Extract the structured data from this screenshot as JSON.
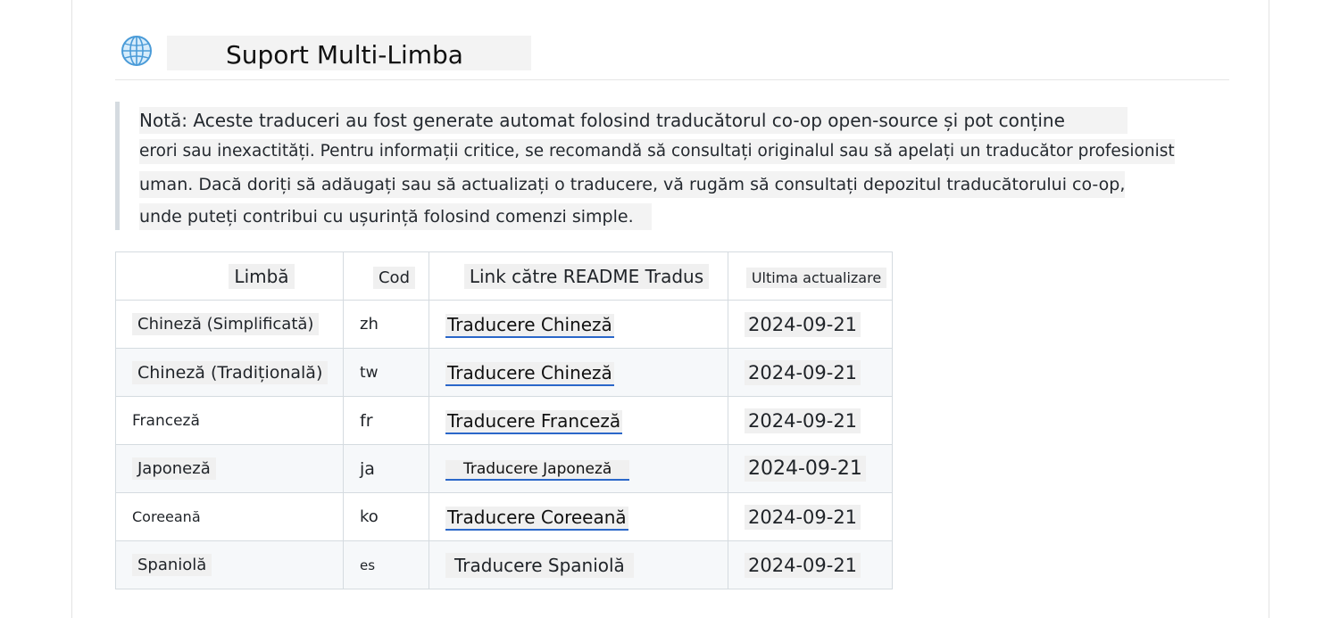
{
  "heading": {
    "title": "Suport Multi-Limba",
    "icon": "globe-icon"
  },
  "note": {
    "lines": [
      "Notă: Aceste traduceri au fost generate automat folosind traducătorul co-op open-source și pot conține",
      "erori sau inexactități. Pentru informații critice, se recomandă să consultați originalul sau să apelați un traducător profesionist",
      "uman. Dacă doriți să adăugați sau să actualizați o traducere, vă rugăm să consultați depozitul traducătorului co-op,",
      "unde puteți contribui cu ușurință folosind comenzi simple."
    ]
  },
  "table": {
    "headers": [
      "Limbă",
      "Cod",
      "Link către README Tradus",
      "Ultima actualizare"
    ],
    "rows": [
      {
        "language": "Chineză (Simplificată)",
        "code": "zh",
        "link": "Traducere Chineză",
        "updated": "2024-09-21"
      },
      {
        "language": "Chineză (Tradițională)",
        "code": "tw",
        "link": "Traducere Chineză",
        "updated": "2024-09-21"
      },
      {
        "language": "Franceză",
        "code": "fr",
        "link": "Traducere Franceză",
        "updated": "2024-09-21"
      },
      {
        "language": "Japoneză",
        "code": "ja",
        "link": "Traducere Japoneză",
        "updated": "2024-09-21"
      },
      {
        "language": "Coreeană",
        "code": "ko",
        "link": "Traducere Coreeană",
        "updated": "2024-09-21"
      },
      {
        "language": "Spaniolă",
        "code": "es",
        "link": "Traducere Spaniolă",
        "updated": "2024-09-21"
      }
    ]
  },
  "colors": {
    "link_underline": "#2a67c9",
    "blockquote_bar": "#d5dbe0"
  }
}
